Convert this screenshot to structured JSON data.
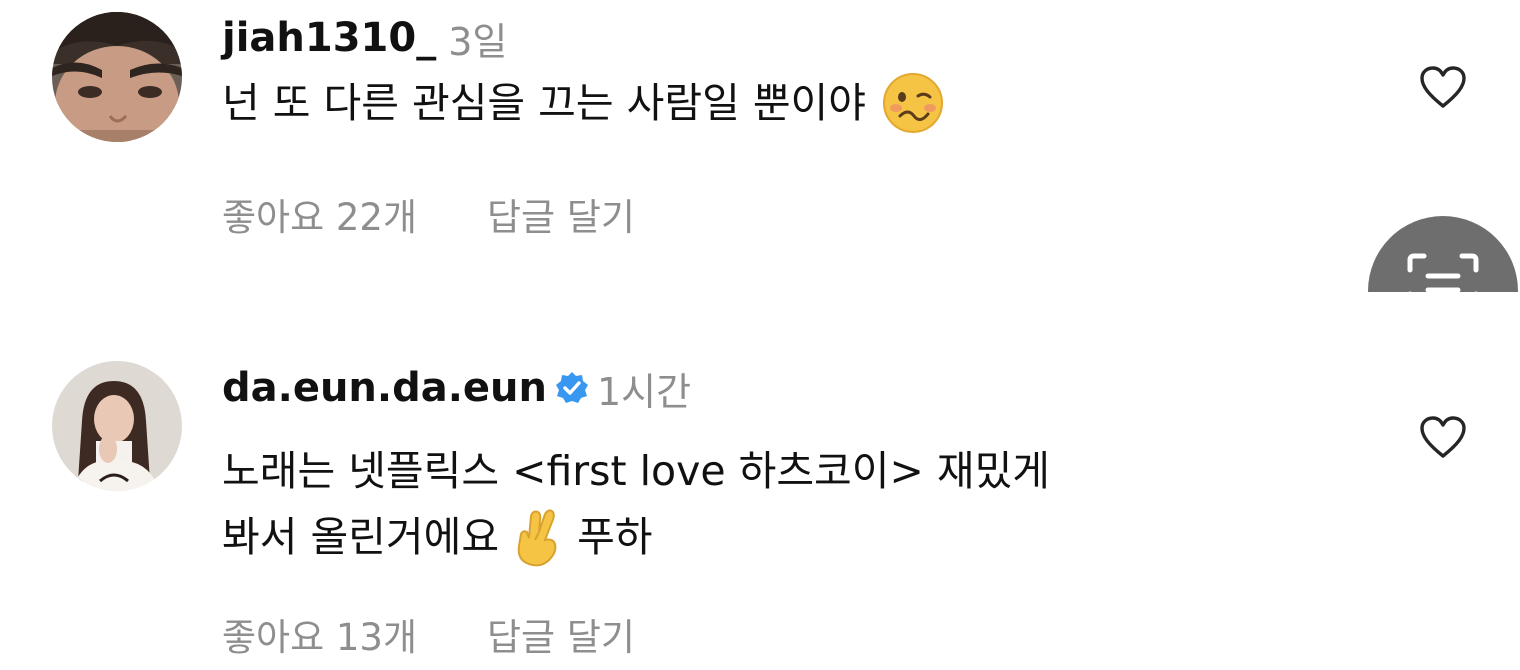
{
  "comments": [
    {
      "username": "jiah1310_",
      "verified": false,
      "time": "3일",
      "text_lines": [
        "넌 또 다른 관심을 끄는 사람일 뿐이야"
      ],
      "emoji": "woozy-face-emoji",
      "likes": "좋아요 22개",
      "reply": "답글 달기",
      "avatar": "avatar-man-selfie"
    },
    {
      "username": "da.eun.da.eun",
      "verified": true,
      "time": "1시간",
      "text_lines": [
        "노래는 넷플릭스 <first love 하츠코이> 재밌게",
        "봐서 올린거에요"
      ],
      "text_tail": "푸하",
      "emoji": "crossed-fingers-emoji",
      "likes": "좋아요 13개",
      "reply": "답글 달기",
      "avatar": "avatar-woman-photo"
    }
  ],
  "icons": {
    "like": "heart-outline-icon",
    "verified": "verified-badge-icon",
    "scan": "scan-text-icon"
  },
  "colors": {
    "text": "#111111",
    "secondary": "#8e8e8e",
    "verified_blue": "#3897f0",
    "scan_button": "#6e6e6e"
  }
}
